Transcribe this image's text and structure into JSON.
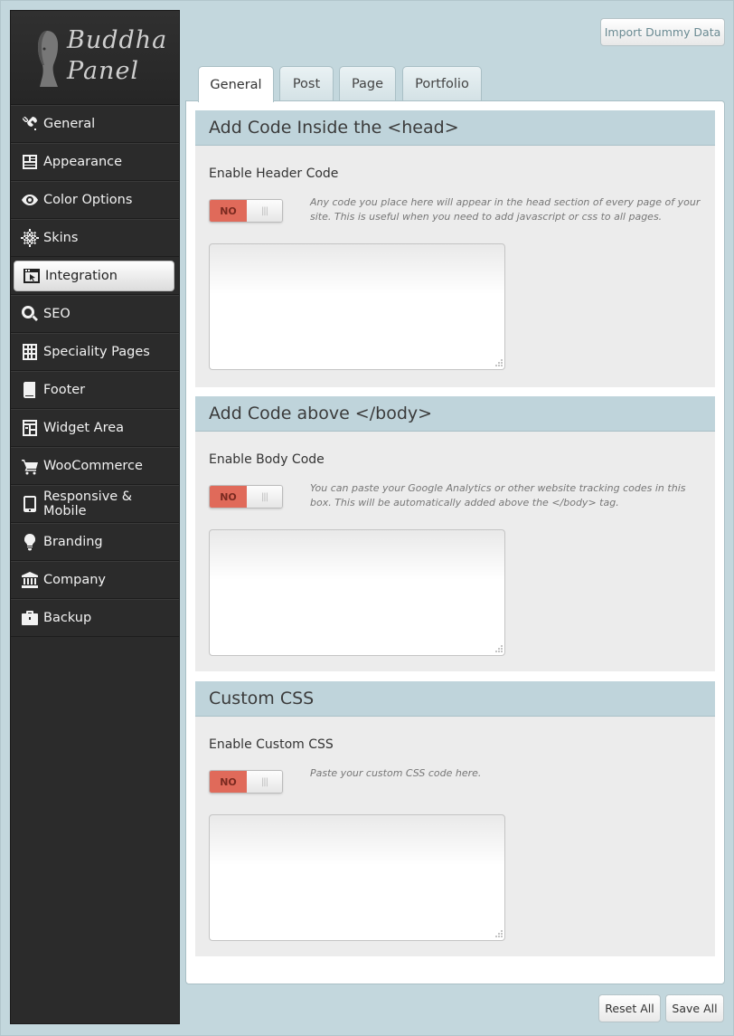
{
  "logo": {
    "line1": "Buddha",
    "line2": "Panel"
  },
  "sidebar": {
    "items": [
      {
        "label": "General",
        "icon": "wrench-icon"
      },
      {
        "label": "Appearance",
        "icon": "newspaper-icon"
      },
      {
        "label": "Color Options",
        "icon": "eye-icon"
      },
      {
        "label": "Skins",
        "icon": "ship-wheel-icon"
      },
      {
        "label": "Integration",
        "icon": "window-cursor-icon",
        "active": true
      },
      {
        "label": "SEO",
        "icon": "search-icon"
      },
      {
        "label": "Speciality Pages",
        "icon": "grid-icon"
      },
      {
        "label": "Footer",
        "icon": "book-icon"
      },
      {
        "label": "Widget Area",
        "icon": "widget-icon"
      },
      {
        "label": "WooCommerce",
        "icon": "cart-icon"
      },
      {
        "label": "Responsive & Mobile",
        "icon": "mobile-icon"
      },
      {
        "label": "Branding",
        "icon": "lightbulb-icon"
      },
      {
        "label": "Company",
        "icon": "bank-icon"
      },
      {
        "label": "Backup",
        "icon": "briefcase-icon"
      }
    ]
  },
  "toolbar": {
    "import_label": "Import Dummy Data",
    "reset_label": "Reset All",
    "save_label": "Save All"
  },
  "tabs": [
    {
      "label": "General",
      "active": true
    },
    {
      "label": "Post"
    },
    {
      "label": "Page"
    },
    {
      "label": "Portfolio"
    }
  ],
  "sections": [
    {
      "title": "Add Code Inside the <head>",
      "field_label": "Enable Header Code",
      "toggle": "NO",
      "knob": "|||",
      "description": "Any code you place here will appear in the head section of every page of your site. This is useful when you need to add javascript or css to all pages.",
      "value": ""
    },
    {
      "title": "Add Code above </body>",
      "field_label": "Enable Body Code",
      "toggle": "NO",
      "knob": "|||",
      "description": "You can paste your Google Analytics or other website tracking codes in this box. This will be automatically added above the </body> tag.",
      "value": ""
    },
    {
      "title": "Custom CSS",
      "field_label": "Enable Custom CSS",
      "toggle": "NO",
      "knob": "|||",
      "description": "Paste your custom CSS code here.",
      "value": ""
    }
  ]
}
